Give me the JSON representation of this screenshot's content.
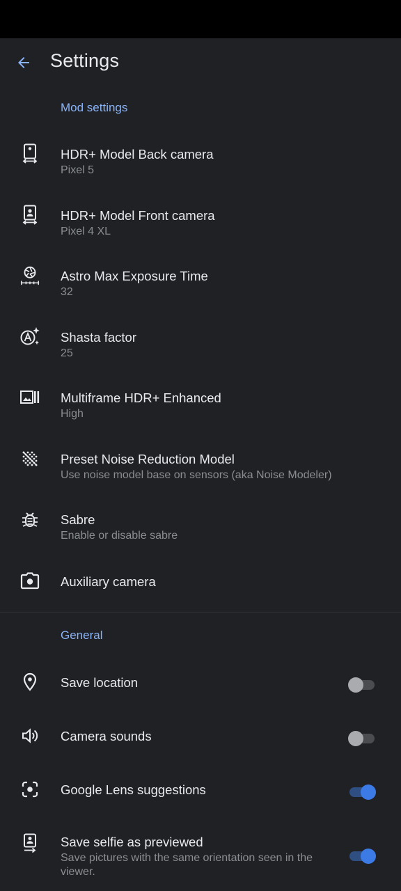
{
  "header": {
    "title": "Settings",
    "back_icon": "arrow-back-icon"
  },
  "colors": {
    "background": "#202124",
    "accent": "#8ab4f8",
    "toggle_on": "#3c7be6",
    "text_primary": "#e8eaed",
    "text_secondary": "#8a8d91"
  },
  "mod_settings": {
    "header": "Mod settings",
    "items": [
      {
        "title": "HDR+ Model Back camera",
        "subtitle": "Pixel 5",
        "icon": "phone-back-camera-icon"
      },
      {
        "title": "HDR+ Model Front camera",
        "subtitle": "Pixel 4 XL",
        "icon": "phone-front-camera-icon"
      },
      {
        "title": "Astro Max Exposure Time",
        "subtitle": "32",
        "icon": "shutter-timer-icon"
      },
      {
        "title": "Shasta factor",
        "subtitle": "25",
        "icon": "auto-sparkle-icon"
      },
      {
        "title": "Multiframe HDR+ Enhanced",
        "subtitle": "High",
        "icon": "burst-image-icon"
      },
      {
        "title": "Preset Noise Reduction Model",
        "subtitle": "Use noise model base on sensors (aka Noise Modeler)",
        "icon": "grain-icon"
      },
      {
        "title": "Sabre",
        "subtitle": "Enable or disable sabre",
        "icon": "bug-icon"
      },
      {
        "title": "Auxiliary camera",
        "icon": "camera-icon"
      }
    ]
  },
  "general": {
    "header": "General",
    "items": [
      {
        "title": "Save location",
        "icon": "location-pin-icon",
        "toggle": false
      },
      {
        "title": "Camera sounds",
        "icon": "speaker-icon",
        "toggle": false
      },
      {
        "title": "Google Lens suggestions",
        "icon": "lens-icon",
        "toggle": true
      },
      {
        "title": "Save selfie as previewed",
        "subtitle": "Save pictures with the same orientation seen in the viewer.",
        "icon": "selfie-mirror-icon",
        "toggle": true
      }
    ]
  }
}
